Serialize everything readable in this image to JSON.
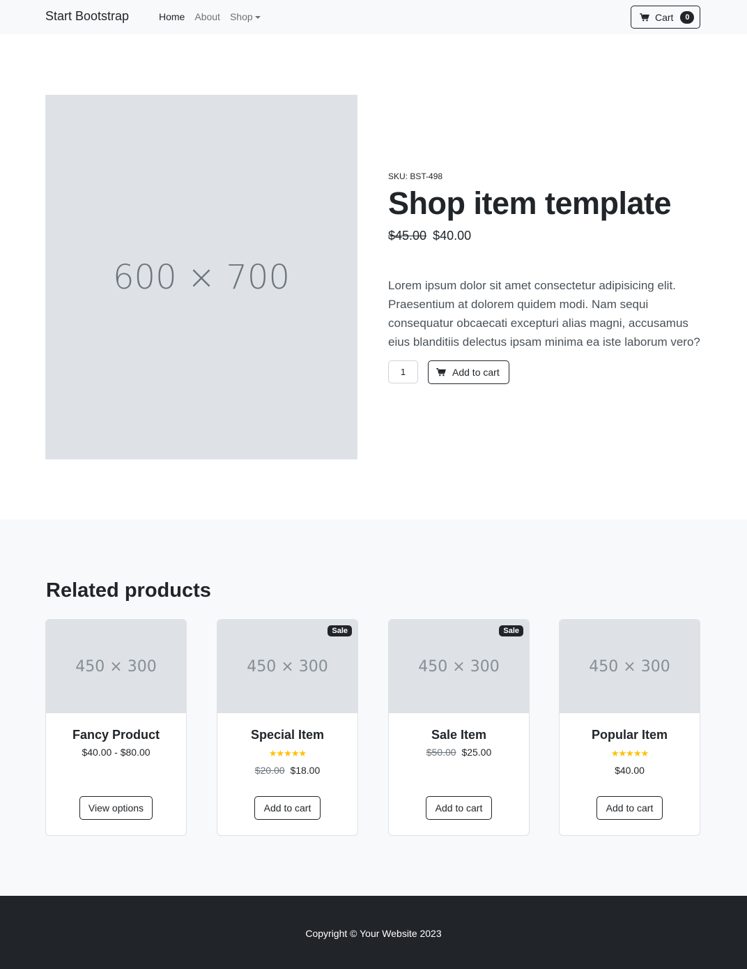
{
  "navbar": {
    "brand": "Start Bootstrap",
    "links": [
      "Home",
      "About",
      "Shop"
    ],
    "cart_label": "Cart",
    "cart_count": "0"
  },
  "product": {
    "image_placeholder": "600 × 700",
    "sku": "SKU: BST-498",
    "title": "Shop item template",
    "old_price": "$45.00",
    "price": "$40.00",
    "description": "Lorem ipsum dolor sit amet consectetur adipisicing elit. Praesentium at dolorem quidem modi. Nam sequi consequatur obcaecati excepturi alias magni, accusamus eius blanditiis delectus ipsam minima ea iste laborum vero?",
    "quantity": "1",
    "add_to_cart_label": "Add to cart"
  },
  "related": {
    "title": "Related products",
    "cards": [
      {
        "image_placeholder": "450 × 300",
        "badge": "",
        "name": "Fancy Product",
        "stars": "",
        "old_price": "",
        "price": "$40.00 - $80.00",
        "button": "View options"
      },
      {
        "image_placeholder": "450 × 300",
        "badge": "Sale",
        "name": "Special Item",
        "stars": "★★★★★",
        "old_price": "$20.00",
        "price": "$18.00",
        "button": "Add to cart"
      },
      {
        "image_placeholder": "450 × 300",
        "badge": "Sale",
        "name": "Sale Item",
        "stars": "",
        "old_price": "$50.00",
        "price": "$25.00",
        "button": "Add to cart"
      },
      {
        "image_placeholder": "450 × 300",
        "badge": "",
        "name": "Popular Item",
        "stars": "★★★★★",
        "old_price": "",
        "price": "$40.00",
        "button": "Add to cart"
      }
    ]
  },
  "footer": {
    "copyright": "Copyright © Your Website 2023"
  },
  "colors": {
    "dark": "#212529",
    "placeholder_bg": "#dee2e6",
    "section_bg": "#f8f9fa",
    "star": "#ffc107"
  },
  "icons": [
    "cart-icon",
    "star-icon"
  ]
}
